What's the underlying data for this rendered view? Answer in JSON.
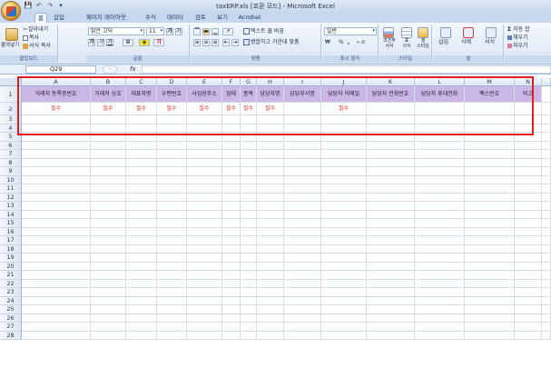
{
  "window": {
    "title": "taxERP.xls [호환 모드] - Microsoft Excel"
  },
  "qat": [
    "💾",
    "↶",
    "↷",
    "▾"
  ],
  "tabs": [
    "홈",
    "삽입",
    "페이지 레이아웃",
    "수식",
    "데이터",
    "검토",
    "보기",
    "Acrobat"
  ],
  "active_tab": "홈",
  "ribbon": {
    "clipboard": {
      "paste": "붙여넣기",
      "cut": "잘라내기",
      "copy": "복사",
      "format_painter": "서식 복사",
      "label": "클립보드"
    },
    "font": {
      "font_name": "맑은 고딕",
      "font_size": "11",
      "grow": "가",
      "shrink": "가",
      "bold": "가",
      "italic": "가",
      "underline": "가",
      "font_color": "가",
      "label": "글꼴"
    },
    "alignment": {
      "wrap": "텍스트 줄 바꿈",
      "merge": "병합하고 가운데 맞춤",
      "label": "맞춤"
    },
    "number": {
      "format": "일반",
      "currency": "₩",
      "percent": "%",
      "comma": ",",
      "label": "표시 형식"
    },
    "styles": {
      "conditional": "조건부\n서식",
      "table": "표\n서식",
      "cell": "셀\n스타일",
      "label": "스타일"
    },
    "cells": {
      "insert": "삽입",
      "delete": "삭제",
      "format": "서식",
      "label": "셀"
    },
    "editing": {
      "autosum": "자동 합",
      "fill": "채우기",
      "clear": "지우기"
    }
  },
  "formula_bar": {
    "name_box": "Q29",
    "fx": "fx",
    "value": ""
  },
  "columns": [
    "A",
    "B",
    "C",
    "D",
    "E",
    "F",
    "G",
    "H",
    "I",
    "J",
    "K",
    "L",
    "M",
    "N"
  ],
  "header_row": [
    "거래처 등록증번호",
    "거래처 상호",
    "대표자명",
    "우편번호",
    "사업장주소",
    "업태",
    "종목",
    "담당자명",
    "담당부서명",
    "담당자 이메일",
    "담당자 전화번호",
    "담당자 휴대전화",
    "팩스번호",
    "비고"
  ],
  "required_row": [
    "필수",
    "필수",
    "필수",
    "필수",
    "필수",
    "필수",
    "필수",
    "필수",
    "",
    "필수",
    "",
    "",
    "",
    ""
  ],
  "row_numbers": [
    "1",
    "2",
    "3",
    "4",
    "5",
    "6",
    "7",
    "8",
    "9",
    "10",
    "11",
    "12",
    "13",
    "14",
    "15",
    "16",
    "17",
    "18",
    "19",
    "20",
    "21",
    "22",
    "23",
    "24",
    "25",
    "26",
    "27",
    "28"
  ],
  "colors": {
    "header_fill": "#cbb7e6",
    "required_text": "#e0302a",
    "highlight_border": "#e21b1b"
  }
}
